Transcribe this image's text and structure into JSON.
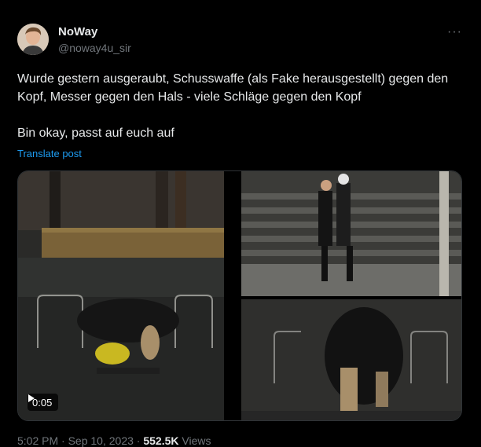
{
  "user": {
    "display_name": "NoWay",
    "handle": "@noway4u_sir"
  },
  "icons": {
    "more": "more-horizontal-icon",
    "play": "play-icon",
    "avatar": "avatar-image"
  },
  "tweet": {
    "text_line1": "Wurde gestern ausgeraubt, Schusswaffe  (als Fake herausgestellt) gegen den Kopf, Messer gegen den Hals - viele Schläge gegen den Kopf",
    "text_line2": "Bin okay, passt auf euch auf",
    "translate_label": "Translate post"
  },
  "video": {
    "duration": "0:05"
  },
  "meta": {
    "time": "5:02 PM",
    "sep1": " · ",
    "date": "Sep 10, 2023",
    "sep2": " · ",
    "views_count": "552.5K",
    "views_label": " Views"
  },
  "colors": {
    "link": "#1d9bf0",
    "text": "#e7e9ea",
    "muted": "#71767b"
  }
}
